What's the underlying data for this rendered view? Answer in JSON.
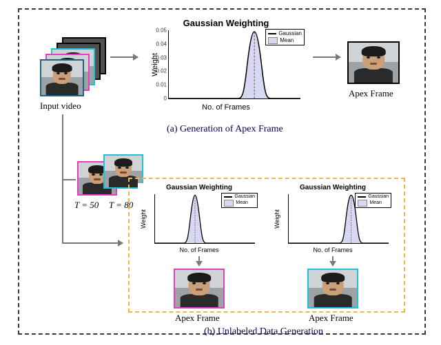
{
  "labels": {
    "input_video": "Input video",
    "apex_frame": "Apex Frame",
    "t50": "T = 50",
    "t80": "T = 80"
  },
  "captions": {
    "a": "(a) Generation of Apex Frame",
    "b": "(b) Unlabeled Data Generation"
  },
  "plot": {
    "title": "Gaussian Weighting",
    "xlabel": "No. of Frames",
    "ylabel": "Weight",
    "legend_gaussian": "Gaussian",
    "legend_mean": "Mean"
  },
  "chart_data": [
    {
      "type": "line",
      "title": "Gaussian Weighting",
      "xlabel": "No. of Frames",
      "ylabel": "Weight",
      "xlim": [
        0,
        200
      ],
      "ylim": [
        0,
        0.05
      ],
      "yticks": [
        0,
        0.01,
        0.02,
        0.03,
        0.04,
        0.05
      ],
      "series": [
        {
          "name": "Gaussian",
          "mean_frame": 130,
          "sigma": 12,
          "peak": 0.05
        },
        {
          "name": "Mean",
          "x": 130
        }
      ]
    },
    {
      "type": "line",
      "title": "Gaussian Weighting",
      "xlabel": "No. of Frames",
      "ylabel": "Weight",
      "xlim": [
        0,
        50
      ],
      "ylim": [
        0,
        0.05
      ],
      "series": [
        {
          "name": "Gaussian",
          "mean_frame": 20,
          "sigma": 4,
          "peak": 0.05
        },
        {
          "name": "Mean",
          "x": 20
        }
      ]
    },
    {
      "type": "line",
      "title": "Gaussian Weighting",
      "xlabel": "No. of Frames",
      "ylabel": "Weight",
      "xlim": [
        0,
        80
      ],
      "ylim": [
        0,
        0.05
      ],
      "series": [
        {
          "name": "Gaussian",
          "mean_frame": 50,
          "sigma": 5,
          "peak": 0.05
        },
        {
          "name": "Mean",
          "x": 50
        }
      ]
    }
  ]
}
